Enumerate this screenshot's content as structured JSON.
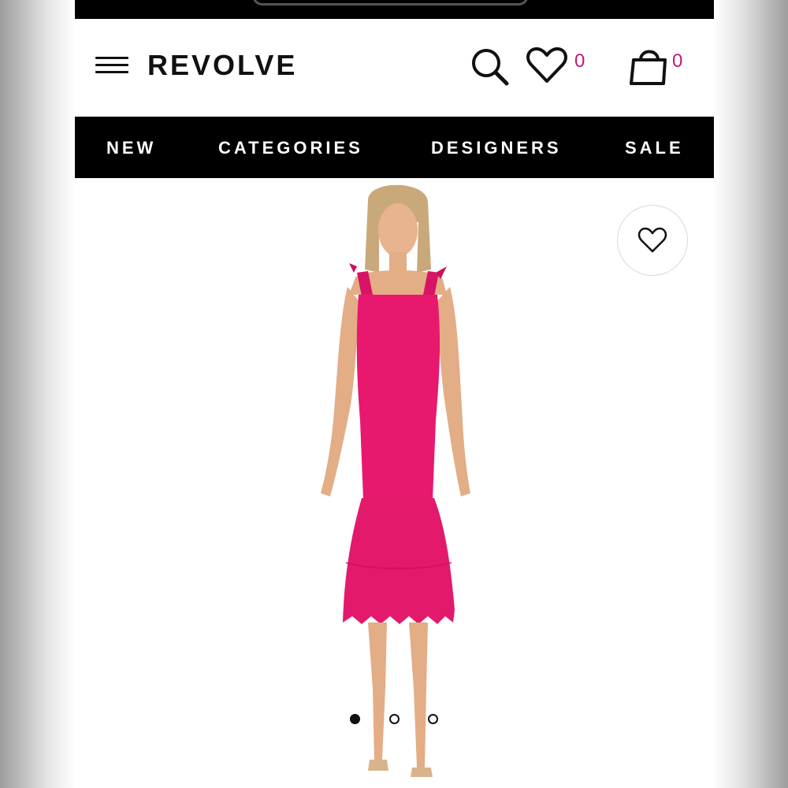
{
  "header": {
    "logo": "REVOLVE",
    "wishlist_count": "0",
    "bag_count": "0"
  },
  "nav": {
    "items": [
      "NEW",
      "CATEGORIES",
      "DESIGNERS",
      "SALE"
    ]
  },
  "product": {
    "image_count": 3,
    "active_image": 1,
    "dress_color": "#e8186f"
  },
  "colors": {
    "accent": "#c2187a",
    "nav_background": "#000000",
    "text": "#111111"
  },
  "icons": [
    "menu-icon",
    "search-icon",
    "heart-icon",
    "shopping-bag-icon",
    "heart-outline-icon"
  ]
}
